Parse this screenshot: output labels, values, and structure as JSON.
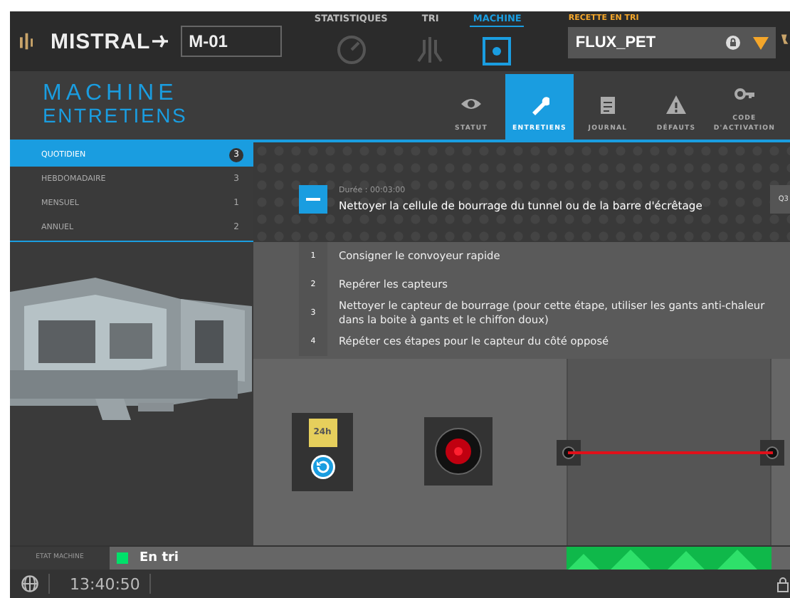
{
  "header": {
    "brand": "MISTRAL",
    "machine_field": {
      "value": "M-01"
    },
    "nav": [
      {
        "label": "STATISTIQUES",
        "selected": false
      },
      {
        "label": "TRI",
        "selected": false
      },
      {
        "label": "MACHINE",
        "selected": true
      }
    ],
    "recipe": {
      "label": "RECETTE EN TRI",
      "value": "FLUX_PET",
      "locked": true
    }
  },
  "page_title": {
    "line1": "MACHINE",
    "line2": "ENTRETIENS"
  },
  "tabs": [
    {
      "label": "STATUT",
      "selected": false
    },
    {
      "label": "ENTRETIENS",
      "selected": true
    },
    {
      "label": "JOURNAL",
      "selected": false
    },
    {
      "label": "DÉFAUTS",
      "selected": false
    },
    {
      "label": "CODE D'ACTIVATION",
      "selected": false
    }
  ],
  "schedules": [
    {
      "label": "QUOTIDIEN",
      "count": "3",
      "selected": true
    },
    {
      "label": "HEBDOMADAIRE",
      "count": "3",
      "selected": false
    },
    {
      "label": "MENSUEL",
      "count": "1",
      "selected": false
    },
    {
      "label": "ANNUEL",
      "count": "2",
      "selected": false
    }
  ],
  "task": {
    "duration": "Durée : 00:03:00",
    "title": "Nettoyer la cellule de bourrage du tunnel ou de la barre d'écrêtage",
    "expanded": true,
    "action": "Q3"
  },
  "steps": [
    {
      "number": "1",
      "text": "Consigner le convoyeur rapide"
    },
    {
      "number": "2",
      "text": "Repérer les capteurs"
    },
    {
      "number": "3",
      "text": "Nettoyer le capteur de bourrage (pour cette étape, utiliser les gants anti-chaleur dans la boite à gants et le chiffon doux)"
    },
    {
      "number": "4",
      "text": "Répéter ces étapes pour le capteur du côté opposé"
    }
  ],
  "indicators": {
    "timer": "24h",
    "sensor_on": true,
    "beam_on": true
  },
  "status": {
    "label": "ETAT MACHINE",
    "value": "En tri",
    "running": true
  },
  "footer": {
    "time": "13:40:50"
  }
}
